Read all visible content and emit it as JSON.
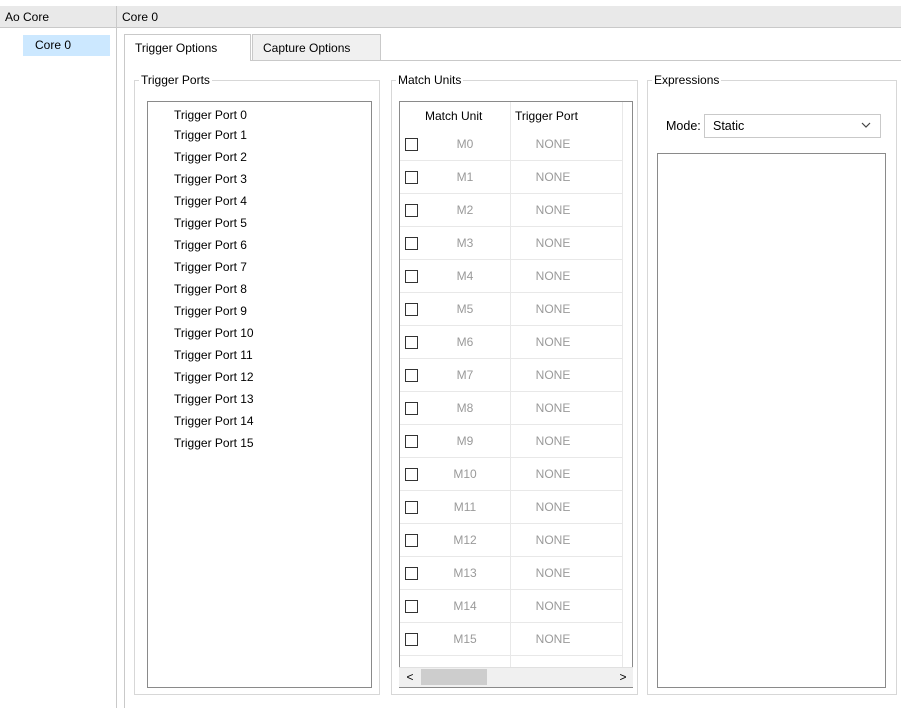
{
  "header": {
    "left_title": "Ao Core",
    "right_title": "Core 0"
  },
  "tree": {
    "items": [
      {
        "label": "Core 0",
        "selected": true
      }
    ]
  },
  "tabs": [
    {
      "label": "Trigger Options",
      "active": true
    },
    {
      "label": "Capture Options",
      "active": false
    }
  ],
  "trigger_ports": {
    "title": "Trigger Ports",
    "items": [
      "Trigger Port 0",
      "Trigger Port 1",
      "Trigger Port 2",
      "Trigger Port 3",
      "Trigger Port 4",
      "Trigger Port 5",
      "Trigger Port 6",
      "Trigger Port 7",
      "Trigger Port 8",
      "Trigger Port 9",
      "Trigger Port 10",
      "Trigger Port 11",
      "Trigger Port 12",
      "Trigger Port 13",
      "Trigger Port 14",
      "Trigger Port 15"
    ]
  },
  "match_units": {
    "title": "Match Units",
    "columns": [
      "Match Unit",
      "Trigger Port"
    ],
    "rows": [
      {
        "unit": "M0",
        "port": "NONE",
        "checked": false
      },
      {
        "unit": "M1",
        "port": "NONE",
        "checked": false
      },
      {
        "unit": "M2",
        "port": "NONE",
        "checked": false
      },
      {
        "unit": "M3",
        "port": "NONE",
        "checked": false
      },
      {
        "unit": "M4",
        "port": "NONE",
        "checked": false
      },
      {
        "unit": "M5",
        "port": "NONE",
        "checked": false
      },
      {
        "unit": "M6",
        "port": "NONE",
        "checked": false
      },
      {
        "unit": "M7",
        "port": "NONE",
        "checked": false
      },
      {
        "unit": "M8",
        "port": "NONE",
        "checked": false
      },
      {
        "unit": "M9",
        "port": "NONE",
        "checked": false
      },
      {
        "unit": "M10",
        "port": "NONE",
        "checked": false
      },
      {
        "unit": "M11",
        "port": "NONE",
        "checked": false
      },
      {
        "unit": "M12",
        "port": "NONE",
        "checked": false
      },
      {
        "unit": "M13",
        "port": "NONE",
        "checked": false
      },
      {
        "unit": "M14",
        "port": "NONE",
        "checked": false
      },
      {
        "unit": "M15",
        "port": "NONE",
        "checked": false
      }
    ],
    "scroll_left_glyph": "<",
    "scroll_right_glyph": ">"
  },
  "expressions": {
    "title": "Expressions",
    "mode_label": "Mode:",
    "mode_value": "Static",
    "chevron_icon": "chevron-down-icon"
  },
  "colors": {
    "selection": "#cce8ff",
    "disabled_text": "#9a9a9a",
    "header_bg": "#e9e9e9"
  }
}
